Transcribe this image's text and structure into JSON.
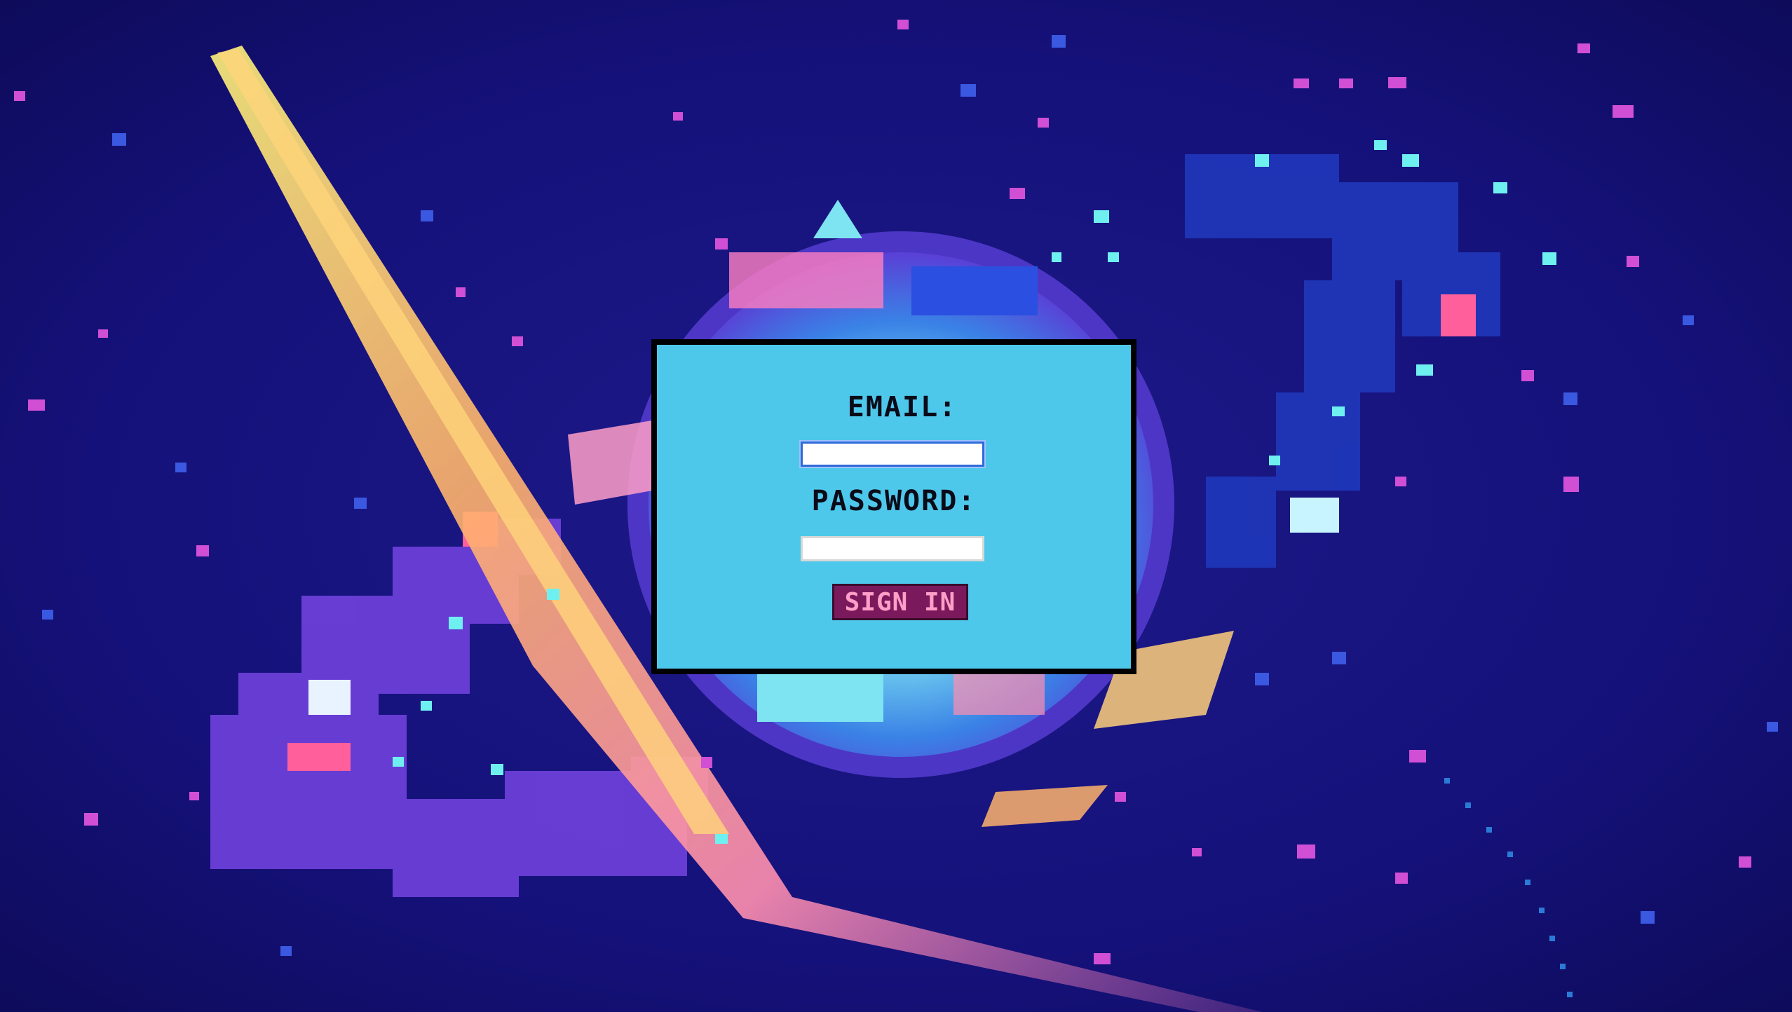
{
  "login": {
    "email_label": "EMAIL:",
    "email_value": "",
    "password_label": "PASSWORD:",
    "password_value": "",
    "signin_label": "SIGN IN"
  },
  "colors": {
    "background": "#14116b",
    "panel": "#4ec8ea",
    "panel_border": "#000000",
    "button_bg": "#7a1a5c",
    "button_text": "#ff9ec8"
  }
}
